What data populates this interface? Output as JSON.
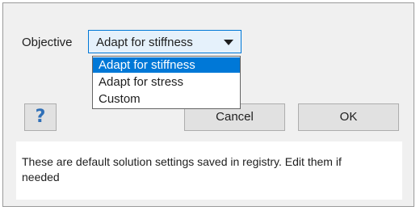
{
  "objective": {
    "label": "Objective",
    "selected_value": "Adapt for stiffness",
    "options": [
      "Adapt for stiffness",
      "Adapt for stress",
      "Custom"
    ]
  },
  "buttons": {
    "help_glyph": "?",
    "cancel_label": "Cancel",
    "ok_label": "OK"
  },
  "info": {
    "text": "These are default solution settings saved in registry. Edit them if needed"
  },
  "colors": {
    "accent": "#0078d7",
    "dialog_background": "#f0f0f0",
    "help_icon": "#2f6fb7"
  },
  "icons": {
    "help": "question-mark-icon",
    "dropdown": "chevron-down-icon"
  }
}
